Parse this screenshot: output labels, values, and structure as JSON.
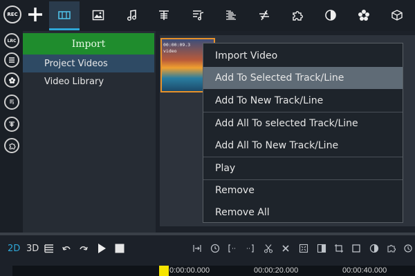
{
  "toolbar": {
    "rec_label": "REC",
    "items": [
      {
        "icon": "plus-icon"
      },
      {
        "icon": "video-panel-icon",
        "active": true
      },
      {
        "icon": "image-icon"
      },
      {
        "icon": "music-note-icon"
      },
      {
        "icon": "text-icon"
      },
      {
        "icon": "music-list-icon"
      },
      {
        "icon": "list-icon"
      },
      {
        "icon": "transition-icon"
      },
      {
        "icon": "puzzle-icon"
      },
      {
        "icon": "contrast-icon"
      },
      {
        "icon": "flower-icon"
      },
      {
        "icon": "cube-icon"
      }
    ]
  },
  "rail": {
    "lrc_label": "LRC",
    "items": [
      "lrc-icon",
      "menu-circle-icon",
      "flower-circle-icon",
      "music-circle-icon",
      "text-circle-icon",
      "puzzle-circle-icon"
    ]
  },
  "panel": {
    "import_label": "Import",
    "nav": [
      {
        "label": "Project Videos",
        "selected": true
      },
      {
        "label": "Video Library",
        "selected": false
      }
    ]
  },
  "thumbnail": {
    "time": "00:00:09.3",
    "label": "video"
  },
  "context_menu": {
    "items": [
      {
        "label": "Import Video"
      },
      {
        "label": "Add To Selected Track/Line",
        "highlighted": true
      },
      {
        "label": "Add To New Track/Line"
      },
      {
        "label": "Add All To selected Track/Line"
      },
      {
        "label": "Add All To New Track/Line"
      },
      {
        "label": "Play"
      },
      {
        "label": "Remove"
      },
      {
        "label": "Remove All"
      }
    ]
  },
  "timeline": {
    "mode_2d": "2D",
    "mode_3d": "3D",
    "ruler_labels": [
      "0:00:00.000",
      "00:00:20.000",
      "00:00:40.000"
    ]
  },
  "colors": {
    "accent_blue": "#2ea7d8",
    "import_green": "#1f8c2d",
    "playhead_yellow": "#f5e400",
    "thumb_border": "#e8922a"
  }
}
